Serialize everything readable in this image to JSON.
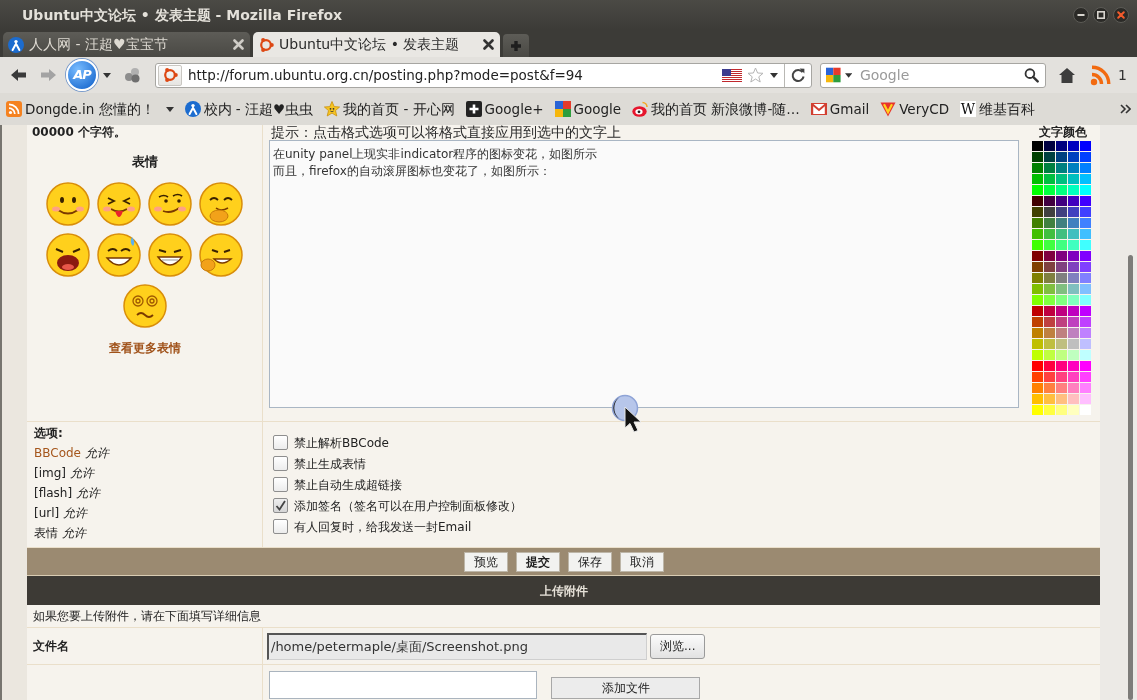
{
  "window": {
    "title": "Ubuntu中文论坛 • 发表主题 - Mozilla Firefox"
  },
  "tabs": [
    {
      "label": "人人网 - 汪超♥宝宝节",
      "selected": false
    },
    {
      "label": "Ubuntu中文论坛 • 发表主题",
      "selected": true
    }
  ],
  "toolbar": {
    "addon_label": "AP",
    "url": "http://forum.ubuntu.org.cn/posting.php?mode=post&f=94",
    "search": {
      "placeholder": "Google"
    },
    "feed_count": "1"
  },
  "bookmarks": [
    {
      "label": "Dongde.in 您懂的！",
      "kind": "folder"
    },
    {
      "label": "校内 - 汪超♥虫虫",
      "kind": "link"
    },
    {
      "label": "我的首页 - 开心网",
      "kind": "link"
    },
    {
      "label": "Google+",
      "kind": "link"
    },
    {
      "label": "Google",
      "kind": "link"
    },
    {
      "label": "我的首页 新浪微博-随…",
      "kind": "link"
    },
    {
      "label": "Gmail",
      "kind": "link"
    },
    {
      "label": "VeryCD",
      "kind": "link"
    },
    {
      "label": "维基百科",
      "kind": "link",
      "favicon_text": "W"
    }
  ],
  "editor": {
    "char_limit_note": "00000 个字符。",
    "smilies_title": "表情",
    "more_smilies": "查看更多表情",
    "hint": "提示：点击格式选项可以将格式直接应用到选中的文字上",
    "message_lines": [
      "在unity panel上现实非indicator程序的图标变花，如图所示",
      "而且，firefox的自动滚屏图标也变花了，如图所示："
    ],
    "color_label": "文字颜色",
    "swatches": [
      {
        "color": "#000000"
      },
      {
        "color": "#000040"
      },
      {
        "color": "#000080"
      },
      {
        "color": "#0000bf"
      },
      {
        "color": "#0000ff"
      },
      {
        "color": "#004000"
      },
      {
        "color": "#004040"
      },
      {
        "color": "#004080"
      },
      {
        "color": "#0040bf"
      },
      {
        "color": "#0040ff"
      },
      {
        "color": "#008000"
      },
      {
        "color": "#008040"
      },
      {
        "color": "#008080"
      },
      {
        "color": "#0080bf"
      },
      {
        "color": "#0080ff"
      },
      {
        "color": "#00bf00"
      },
      {
        "color": "#00bf40"
      },
      {
        "color": "#00bf80"
      },
      {
        "color": "#00bfbf"
      },
      {
        "color": "#00bfff"
      },
      {
        "color": "#00ff00"
      },
      {
        "color": "#00ff40"
      },
      {
        "color": "#00ff80"
      },
      {
        "color": "#00ffbf"
      },
      {
        "color": "#00ffff"
      },
      {
        "color": "#400000"
      },
      {
        "color": "#400040"
      },
      {
        "color": "#400080"
      },
      {
        "color": "#4000bf"
      },
      {
        "color": "#4000ff"
      },
      {
        "color": "#404000"
      },
      {
        "color": "#404040"
      },
      {
        "color": "#404080"
      },
      {
        "color": "#4040bf"
      },
      {
        "color": "#4040ff"
      },
      {
        "color": "#408000"
      },
      {
        "color": "#408040"
      },
      {
        "color": "#408080"
      },
      {
        "color": "#4080bf"
      },
      {
        "color": "#4080ff"
      },
      {
        "color": "#40bf00"
      },
      {
        "color": "#40bf40"
      },
      {
        "color": "#40bf80"
      },
      {
        "color": "#40bfbf"
      },
      {
        "color": "#40bfff"
      },
      {
        "color": "#40ff00"
      },
      {
        "color": "#40ff40"
      },
      {
        "color": "#40ff80"
      },
      {
        "color": "#40ffbf"
      },
      {
        "color": "#40ffff"
      },
      {
        "color": "#800000"
      },
      {
        "color": "#800040"
      },
      {
        "color": "#800080"
      },
      {
        "color": "#8000bf"
      },
      {
        "color": "#8000ff"
      },
      {
        "color": "#804000"
      },
      {
        "color": "#804040"
      },
      {
        "color": "#804080"
      },
      {
        "color": "#8040bf"
      },
      {
        "color": "#8040ff"
      },
      {
        "color": "#808000"
      },
      {
        "color": "#808040"
      },
      {
        "color": "#808080"
      },
      {
        "color": "#8080bf"
      },
      {
        "color": "#8080ff"
      },
      {
        "color": "#80bf00"
      },
      {
        "color": "#80bf40"
      },
      {
        "color": "#80bf80"
      },
      {
        "color": "#80bfbf"
      },
      {
        "color": "#80bfff"
      },
      {
        "color": "#80ff00"
      },
      {
        "color": "#80ff40"
      },
      {
        "color": "#80ff80"
      },
      {
        "color": "#80ffbf"
      },
      {
        "color": "#80ffff"
      },
      {
        "color": "#bf0000"
      },
      {
        "color": "#bf0040"
      },
      {
        "color": "#bf0080"
      },
      {
        "color": "#bf00bf"
      },
      {
        "color": "#bf00ff"
      },
      {
        "color": "#bf4000"
      },
      {
        "color": "#bf4040"
      },
      {
        "color": "#bf4080"
      },
      {
        "color": "#bf40bf"
      },
      {
        "color": "#bf40ff"
      },
      {
        "color": "#bf8000"
      },
      {
        "color": "#bf8040"
      },
      {
        "color": "#bf8080"
      },
      {
        "color": "#bf80bf"
      },
      {
        "color": "#bf80ff"
      },
      {
        "color": "#bfbf00"
      },
      {
        "color": "#bfbf40"
      },
      {
        "color": "#bfbf80"
      },
      {
        "color": "#bfbfbf"
      },
      {
        "color": "#bfbfff"
      },
      {
        "color": "#bfff00"
      },
      {
        "color": "#bfff40"
      },
      {
        "color": "#bfff80"
      },
      {
        "color": "#bfffbf"
      },
      {
        "color": "#bfffff"
      },
      {
        "color": "#ff0000"
      },
      {
        "color": "#ff0040"
      },
      {
        "color": "#ff0080"
      },
      {
        "color": "#ff00bf"
      },
      {
        "color": "#ff00ff"
      },
      {
        "color": "#ff4000"
      },
      {
        "color": "#ff4040"
      },
      {
        "color": "#ff4080"
      },
      {
        "color": "#ff40bf"
      },
      {
        "color": "#ff40ff"
      },
      {
        "color": "#ff8000"
      },
      {
        "color": "#ff8040"
      },
      {
        "color": "#ff8080"
      },
      {
        "color": "#ff80bf"
      },
      {
        "color": "#ff80ff"
      },
      {
        "color": "#ffbf00"
      },
      {
        "color": "#ffbf40"
      },
      {
        "color": "#ffbf80"
      },
      {
        "color": "#ffbfbf"
      },
      {
        "color": "#ffbfff"
      },
      {
        "color": "#ffff00"
      },
      {
        "color": "#ffff40"
      },
      {
        "color": "#ffff80"
      },
      {
        "color": "#ffffbf"
      },
      {
        "color": "#ffffff"
      }
    ]
  },
  "options": {
    "title": "选项:",
    "permissions": [
      {
        "label": "BBCode",
        "kind": "link",
        "status": "允许"
      },
      {
        "label": "[img]",
        "kind": "text",
        "status": "允许"
      },
      {
        "label": "[flash]",
        "kind": "text",
        "status": "允许"
      },
      {
        "label": "[url]",
        "kind": "text",
        "status": "允许"
      },
      {
        "label": "表情",
        "kind": "text",
        "status": "允许"
      }
    ],
    "checkboxes": [
      {
        "label": "禁止解析BBCode",
        "checked": false
      },
      {
        "label": "禁止生成表情",
        "checked": false
      },
      {
        "label": "禁止自动生成超链接",
        "checked": false
      },
      {
        "label": "添加签名（签名可以在用户控制面板修改）",
        "checked": true
      },
      {
        "label": "有人回复时，给我发送一封Email",
        "checked": false
      }
    ]
  },
  "actions": [
    {
      "label": "预览",
      "primary": false
    },
    {
      "label": "提交",
      "primary": true
    },
    {
      "label": "保存",
      "primary": false
    },
    {
      "label": "取消",
      "primary": false
    }
  ],
  "upload": {
    "title": "上传附件",
    "note": "如果您要上传附件，请在下面填写详细信息",
    "file_label": "文件名",
    "file_path": "/home/petermaple/桌面/Screenshot.png",
    "browse_label": "浏览...",
    "add_label": "添加文件"
  }
}
